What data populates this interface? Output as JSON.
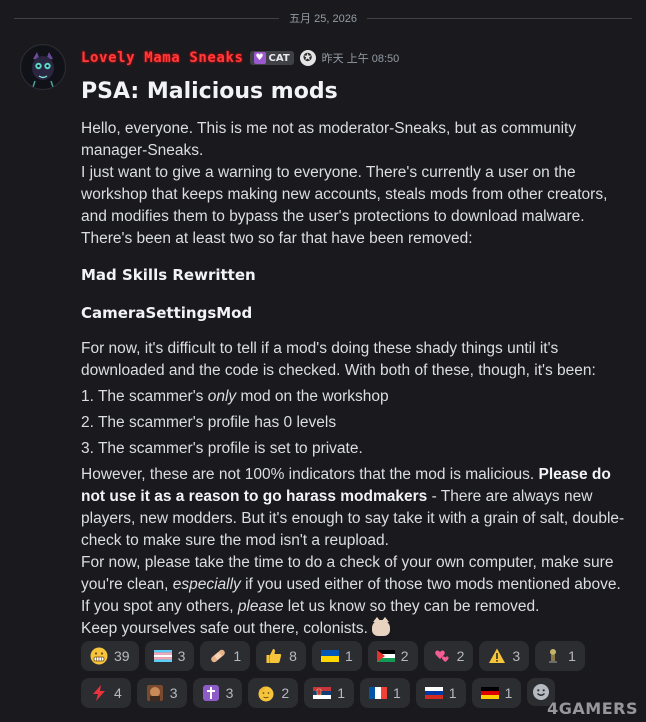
{
  "date_divider": "五月 25, 2026",
  "message": {
    "username": "Lovely Mama Sneaks",
    "tag_label": "CAT",
    "timestamp": "昨天 上午 08:50",
    "title": "PSA: Malicious mods",
    "intro_1": "Hello, everyone. This is me not as moderator-Sneaks, but as community manager-Sneaks.",
    "intro_2": "I just want to give a warning to everyone. There's currently a user on the workshop that keeps making new accounts, steals mods from other creators, and modifies them to bypass the user's protections to download malware. There's been at least two so far that have been removed:",
    "mod_1": "CameraSettingsMod",
    "mod_2": "Mad Skills Rewritten",
    "para_2": "For now, it's difficult to tell if a mod's doing these shady things until it's downloaded and the code is checked. With both of these, though, it's been:",
    "list_1_pre": "1. The scammer's ",
    "list_1_em": "only",
    "list_1_post": " mod on the workshop",
    "list_2": "2. The scammer's profile has 0 levels",
    "list_3": "3. The scammer's profile is set to private.",
    "para_3_pre": "However, these are not 100% indicators that the mod is malicious. ",
    "para_3_bold": "Please do not use it as a reason to go harass modmakers",
    "para_3_post": " - There are always new players, new modders. But it's enough to say take it with a grain of salt, double-check to make sure the mod isn't a reupload.",
    "para_4_pre": "For now, please take the time to do a check of your own computer, make sure you're clean, ",
    "para_4_em": "especially",
    "para_4_post": " if you used either of those two mods mentioned above.",
    "para_5_pre": "If you spot any others, ",
    "para_5_em": "please",
    "para_5_post": " let us know so they can be removed.",
    "para_6": "Keep yourselves safe out there, colonists."
  },
  "reactions": {
    "row1": [
      {
        "icon": "grimacing-face-emoji",
        "count": "39"
      },
      {
        "icon": "transgender-flag-emoji",
        "count": "3"
      },
      {
        "icon": "bandage-emoji",
        "count": "1"
      },
      {
        "icon": "thumbs-up-emoji",
        "count": "8"
      },
      {
        "icon": "ukraine-flag-emoji",
        "count": "1"
      },
      {
        "icon": "palestine-flag-emoji",
        "count": "2"
      },
      {
        "icon": "two-hearts-emoji",
        "count": "2"
      },
      {
        "icon": "warning-emoji",
        "count": "3"
      },
      {
        "icon": "custom-figure-emoji",
        "count": "1"
      }
    ],
    "row2": [
      {
        "icon": "lightning-emoji",
        "count": "4"
      },
      {
        "icon": "custom-face-emoji",
        "count": "3"
      },
      {
        "icon": "latin-cross-emoji",
        "count": "3"
      },
      {
        "icon": "saluting-face-emoji",
        "count": "2"
      },
      {
        "icon": "serbia-flag-emoji",
        "count": "1"
      },
      {
        "icon": "france-flag-emoji",
        "count": "1"
      },
      {
        "icon": "russia-flag-emoji",
        "count": "1"
      },
      {
        "icon": "germany-flag-emoji",
        "count": "1"
      }
    ]
  },
  "watermark": "4GAMERS",
  "colors": {
    "background": "#1a1a1e",
    "username": "#ff3b3b",
    "reaction_bg": "#2b2d31",
    "text": "#dbdee1",
    "muted": "#949ba4"
  }
}
